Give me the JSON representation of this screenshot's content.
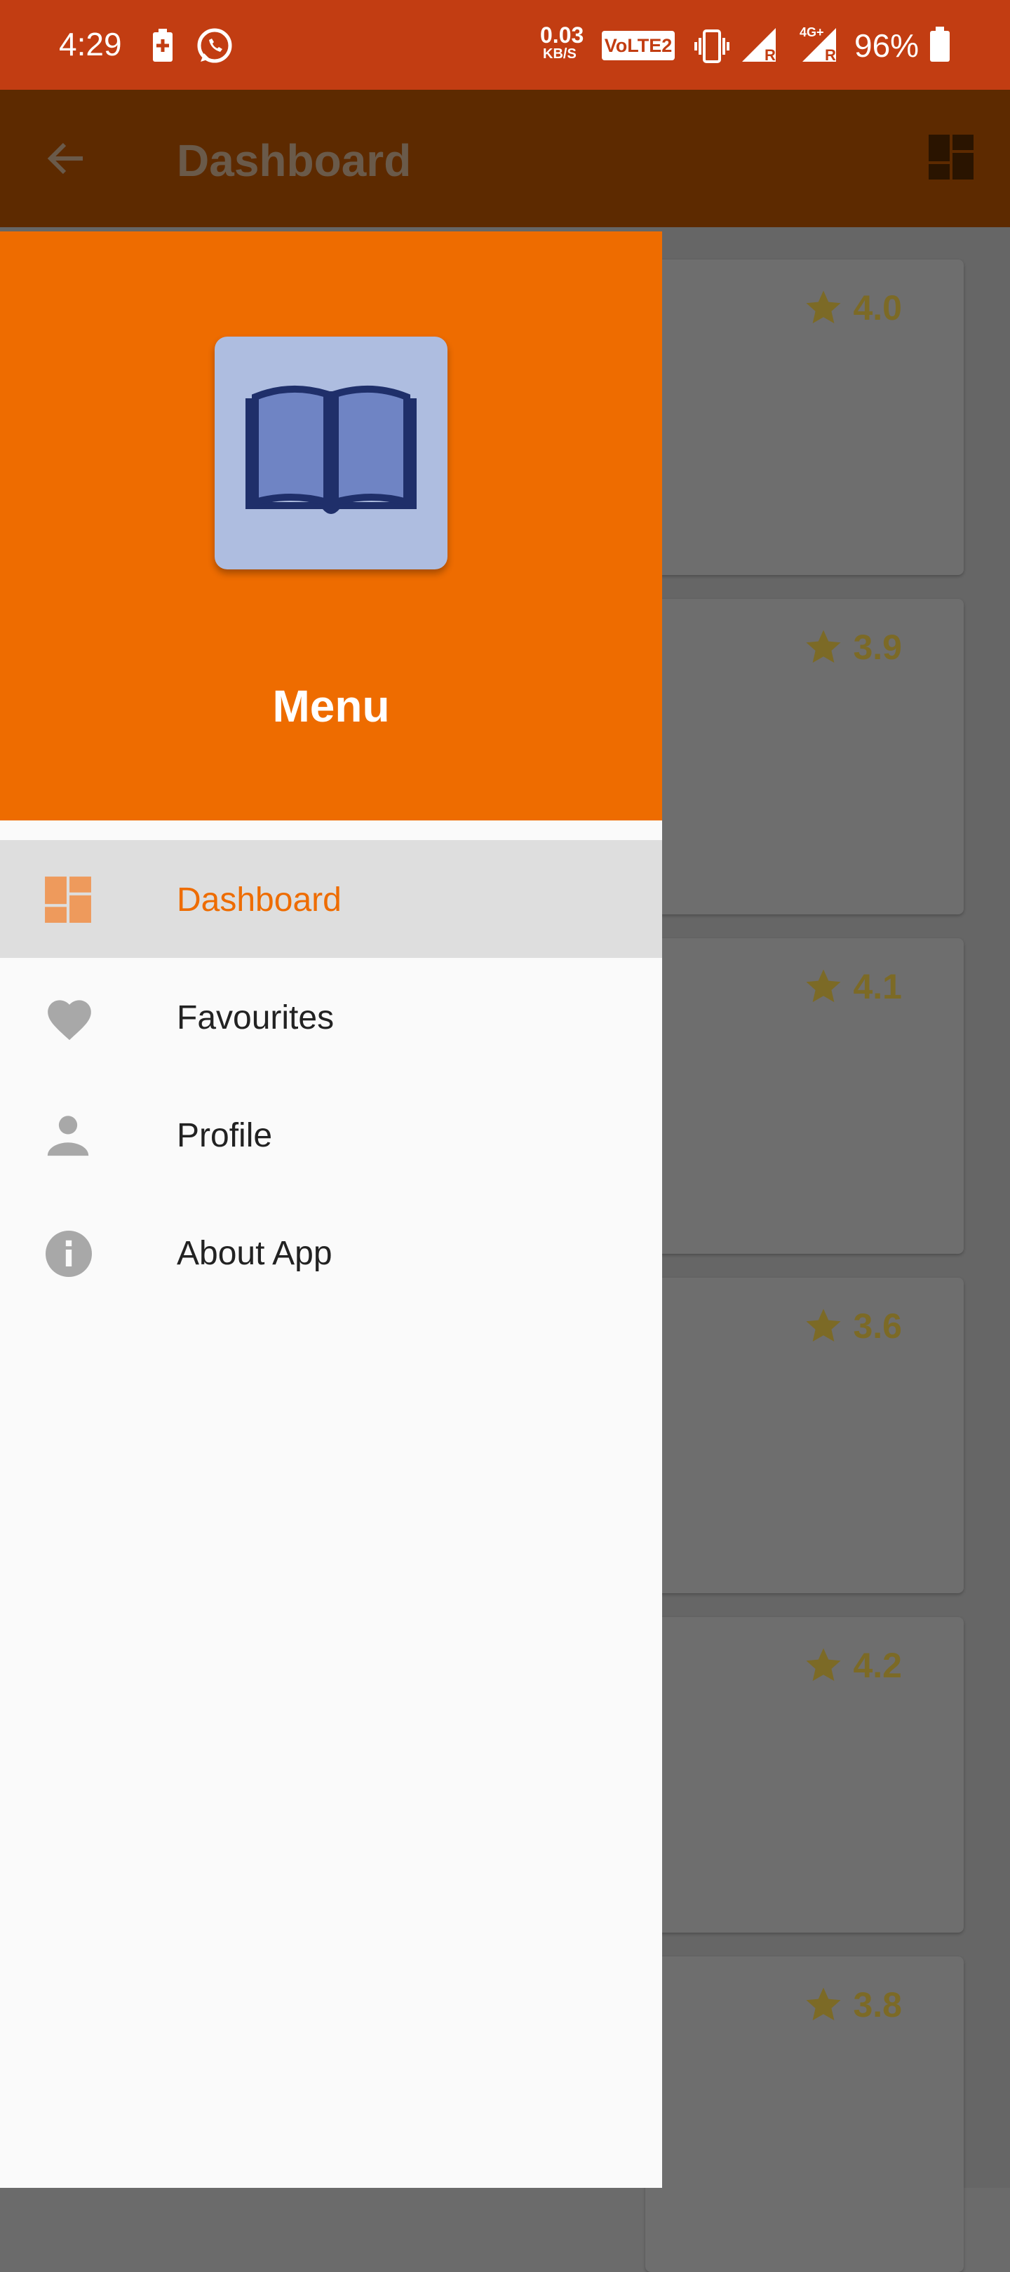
{
  "status_bar": {
    "time": "4:29",
    "net_speed_value": "0.03",
    "net_speed_unit": "KB/S",
    "volte": "VoLTE2",
    "lte_label": "4G+",
    "roaming_r": "R",
    "battery": "96%",
    "icons": [
      "battery-saver-icon",
      "whatsapp-icon",
      "vibrate-icon",
      "signal-icon",
      "battery-icon"
    ]
  },
  "appbar": {
    "title": "Dashboard",
    "back_icon": "back-arrow-icon",
    "action_icon": "dashboard-icon"
  },
  "drawer": {
    "header_title": "Menu",
    "logo_icon": "open-book-icon",
    "items": [
      {
        "label": "Dashboard",
        "icon": "dashboard-icon",
        "active": true
      },
      {
        "label": "Favourites",
        "icon": "heart-icon",
        "active": false
      },
      {
        "label": "Profile",
        "icon": "person-icon",
        "active": false
      },
      {
        "label": "About App",
        "icon": "info-icon",
        "active": false
      }
    ]
  },
  "cards": [
    {
      "rating": "4.0"
    },
    {
      "rating": "3.9"
    },
    {
      "rating": "4.1"
    },
    {
      "rating": "3.6"
    },
    {
      "rating": "4.2"
    },
    {
      "rating": "3.8"
    }
  ],
  "colors": {
    "status_bar": "#c23d12",
    "app_bar": "#5d2a00",
    "drawer_header": "#ee6c00",
    "active_item_text": "#ee6c00",
    "active_item_bg": "#dedede",
    "rating_star": "#7c6a26"
  }
}
